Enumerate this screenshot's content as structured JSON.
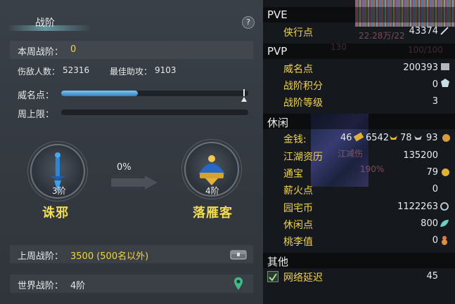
{
  "left": {
    "title": "战阶",
    "help": "?",
    "week_label": "本周战阶：",
    "week_value": "0",
    "kills_label": "伤敌人数：",
    "kills_value": "52316",
    "assist_label": "最佳助攻：",
    "assist_value": "9103",
    "fame_label": "威名点：",
    "fame_progress": 0.41,
    "weekly_cap_label": "周上限：",
    "weekly_cap_progress": 0,
    "progress_text": "0%",
    "current_rank": {
      "level": "3阶",
      "name": "诛邪"
    },
    "next_rank": {
      "level": "4阶",
      "name": "落雁客"
    },
    "last_week_label": "上周战阶：",
    "last_week_value": "3500 (500名以外)",
    "world_label": "世界战阶：",
    "world_value": "4阶"
  },
  "right": {
    "pve": {
      "title": "PVE",
      "items": [
        {
          "label": "侠行点",
          "value": "43374"
        }
      ]
    },
    "pvp": {
      "title": "PVP",
      "items": [
        {
          "label": "威名点",
          "value": "200393"
        },
        {
          "label": "战阶积分",
          "value": "0"
        },
        {
          "label": "战阶等级",
          "value": "3"
        }
      ]
    },
    "leisure": {
      "title": "休闲",
      "money_label": "金钱:",
      "money": [
        "46",
        "6542",
        "78",
        "93"
      ],
      "items": [
        {
          "label": "江湖资历",
          "value": "135200"
        },
        {
          "label": "通宝",
          "value": "79"
        },
        {
          "label": "薪火点",
          "value": "0"
        },
        {
          "label": "园宅币",
          "value": "1122263"
        },
        {
          "label": "休闲点",
          "value": "800"
        },
        {
          "label": "桃李值",
          "value": "0"
        }
      ]
    },
    "other": {
      "title": "其他",
      "items": [
        {
          "label": "网络延迟",
          "value": "45",
          "checked": true
        }
      ]
    },
    "bg_text": {
      "t1": "22.28万/22",
      "t2": "130",
      "t3": "100/100",
      "t4": "江减伤",
      "t5": "190%"
    }
  },
  "colors": {
    "gold": "#f0d443",
    "panel_left": "#353b42",
    "panel_right": "#15181c",
    "progress_blue": "#2f7fc4"
  }
}
